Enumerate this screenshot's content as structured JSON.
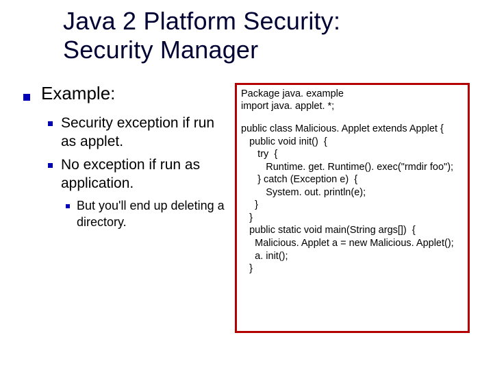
{
  "title_line1": "Java 2 Platform Security:",
  "title_line2": "Security Manager",
  "heading": "Example:",
  "subpoints": [
    "Security exception if run as applet.",
    "No exception if run as application."
  ],
  "subsub": "But you'll end up deleting a directory.",
  "code": {
    "l1": "Package java. example",
    "l2": "import java. applet. *;",
    "l3": "public class Malicious. Applet extends Applet {",
    "l4": "   public void init()  {",
    "l5": "      try  {",
    "l6": "         Runtime. get. Runtime(). exec(\"rmdir foo\");",
    "l7": "      } catch (Exception e)  {",
    "l8": "         System. out. println(e);",
    "l9": "     }",
    "l10": "   }",
    "l11": "   public static void main(String args[])  {",
    "l12": "     Malicious. Applet a = new Malicious. Applet();",
    "l13": "     a. init();",
    "l14": "   }"
  }
}
